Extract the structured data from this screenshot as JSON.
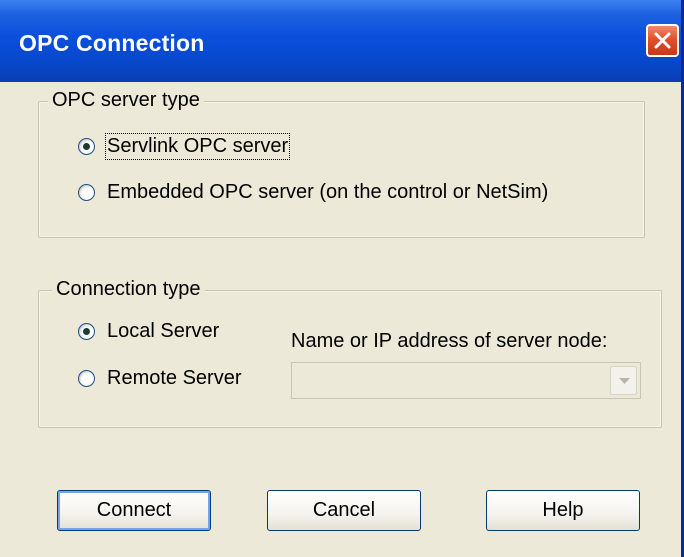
{
  "window": {
    "title": "OPC Connection",
    "close_icon": "close-icon"
  },
  "server_type_group": {
    "legend": "OPC server type",
    "options": [
      {
        "label": "Servlink OPC server",
        "checked": true
      },
      {
        "label": "Embedded OPC server (on the control or NetSim)",
        "checked": false
      }
    ]
  },
  "connection_group": {
    "legend": "Connection type",
    "options": [
      {
        "label": "Local Server",
        "checked": true
      },
      {
        "label": "Remote Server",
        "checked": false
      }
    ],
    "node_label": "Name or IP address of server node:",
    "node_value": "",
    "dropdown_icon": "chevron-down-icon"
  },
  "buttons": {
    "connect": "Connect",
    "cancel": "Cancel",
    "help": "Help"
  },
  "colors": {
    "titlebar": "#0a4fdc",
    "dialog_bg": "#ece9d8",
    "close_button": "#e2512b"
  }
}
